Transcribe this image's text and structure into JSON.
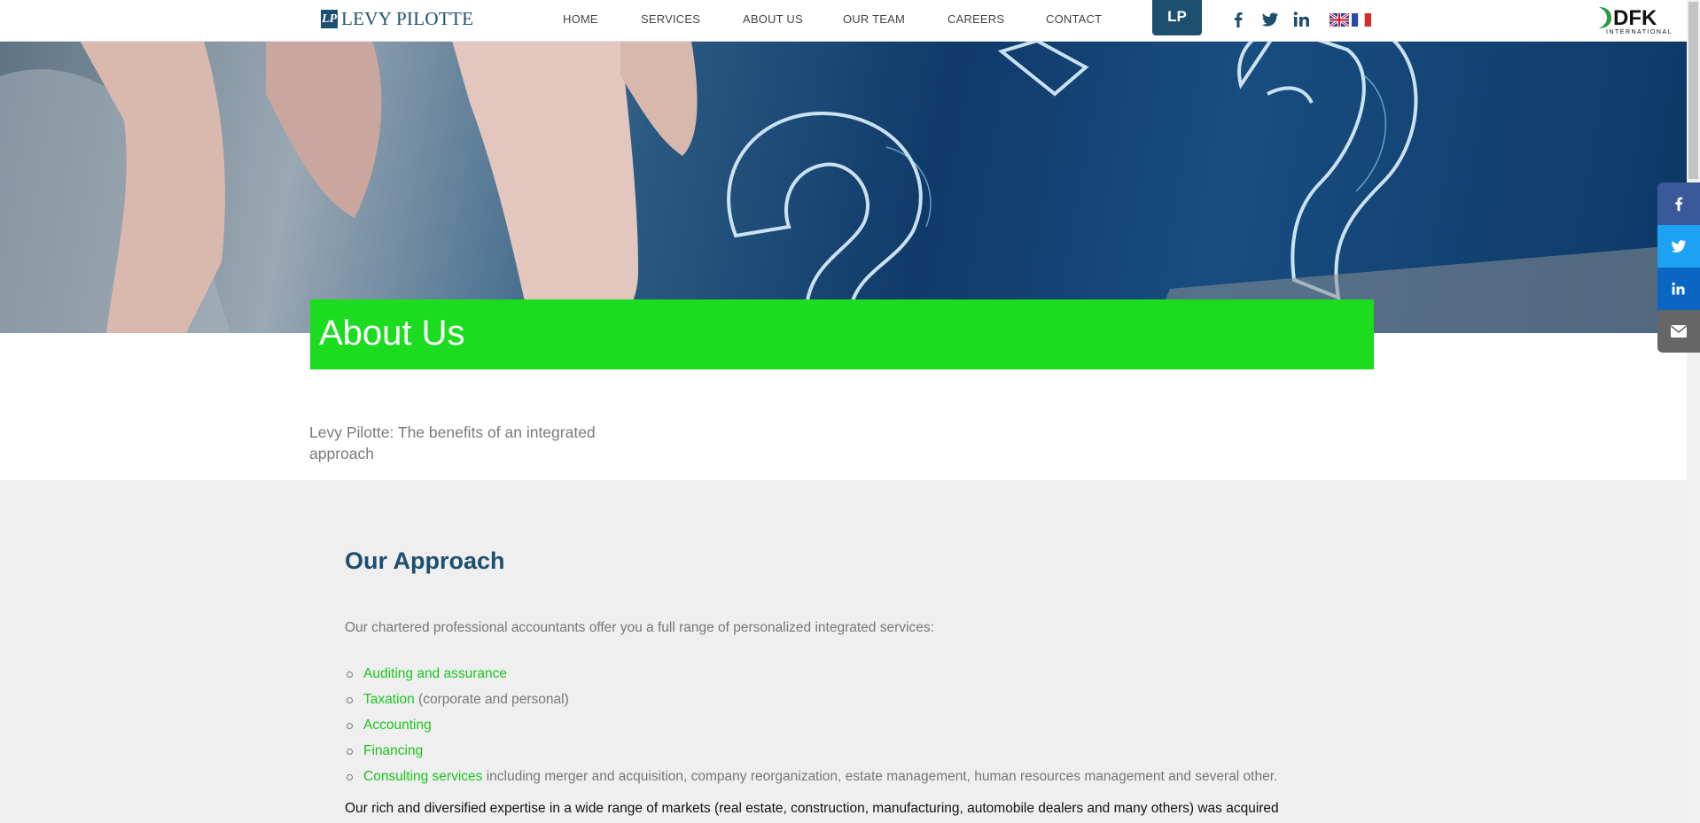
{
  "header": {
    "logo_text": "LEVY PILOTTE",
    "logo_mark": "LP",
    "nav": [
      {
        "label": "HOME"
      },
      {
        "label": "SERVICES"
      },
      {
        "label": "ABOUT US"
      },
      {
        "label": "OUR TEAM"
      },
      {
        "label": "CAREERS"
      },
      {
        "label": "CONTACT"
      }
    ],
    "lp_button": "LP",
    "social": [
      "facebook-icon",
      "twitter-icon",
      "linkedin-icon"
    ],
    "languages": [
      "en-flag",
      "fr-flag"
    ],
    "partner_logo": "DFK",
    "partner_sub": "INTERNATIONAL"
  },
  "hero": {
    "title": "About Us",
    "subtitle": "Levy Pilotte: The benefits of an integrated approach"
  },
  "approach": {
    "heading": "Our Approach",
    "intro": "Our chartered professional accountants offer you a full range of personalized integrated services:",
    "services": [
      {
        "link": "Auditing and assurance",
        "rest": ""
      },
      {
        "link": "Taxation",
        "rest": " (corporate and personal)"
      },
      {
        "link": "Accounting",
        "rest": ""
      },
      {
        "link": "Financing",
        "rest": ""
      },
      {
        "link": "Consulting services",
        "rest": " including merger and acquisition, company reorganization, estate management, human resources management and several other."
      }
    ],
    "rich_text": "Our rich and diversified expertise in a wide range of markets (real estate, construction, manufacturing, automobile dealers and many others) was acquired"
  },
  "share_rail": [
    "facebook-icon",
    "twitter-icon",
    "linkedin-icon",
    "email-icon"
  ],
  "colors": {
    "brand_blue": "#1d4f6e",
    "banner_green": "#1bdc1f",
    "link_green": "#1bc41e",
    "section_bg": "#efefef"
  }
}
